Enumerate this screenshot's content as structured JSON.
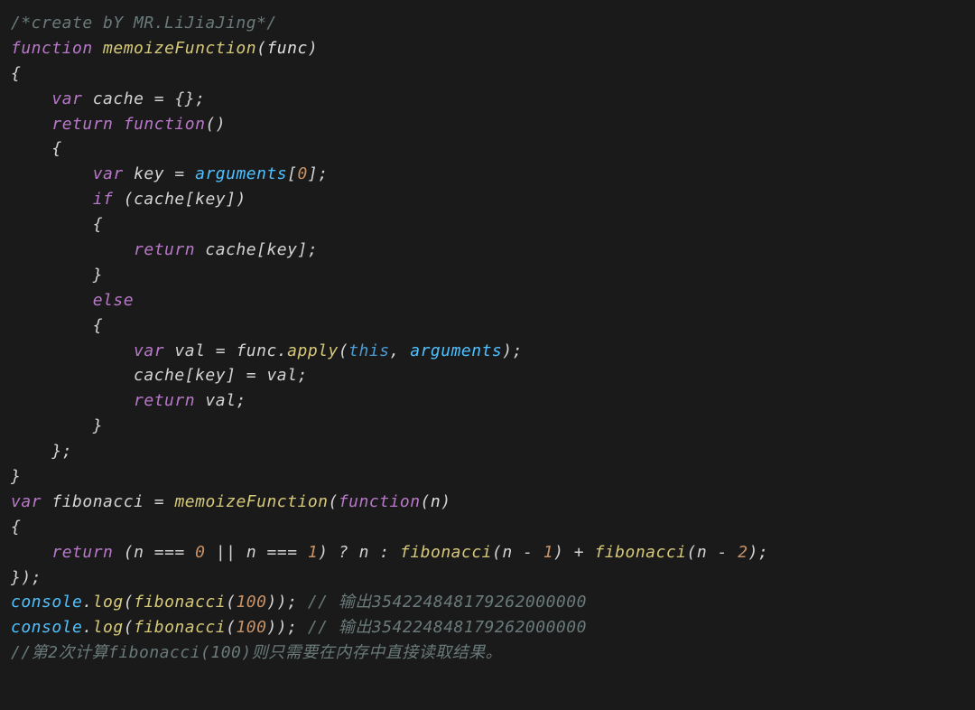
{
  "code": {
    "c1": "/*create bY MR.LiJiaJing*/",
    "kw_function": "function",
    "fn_memoize": "memoizeFunction",
    "param_func": "func",
    "kw_var": "var",
    "id_cache": "cache",
    "kw_return": "return",
    "id_key": "key",
    "id_arguments": "arguments",
    "num_0": "0",
    "kw_if": "if",
    "kw_else": "else",
    "id_val": "val",
    "id_func": "func",
    "id_apply": "apply",
    "kw_this": "this",
    "id_fibonacci": "fibonacci",
    "param_n": "n",
    "num_1": "1",
    "num_2": "2",
    "id_console": "console",
    "id_log": "log",
    "num_100": "100",
    "c_out1": "// 输出354224848179262000000",
    "c_out2": "// 输出354224848179262000000",
    "c_last": "//第2次计算fibonacci(100)则只需要在内存中直接读取结果。"
  }
}
